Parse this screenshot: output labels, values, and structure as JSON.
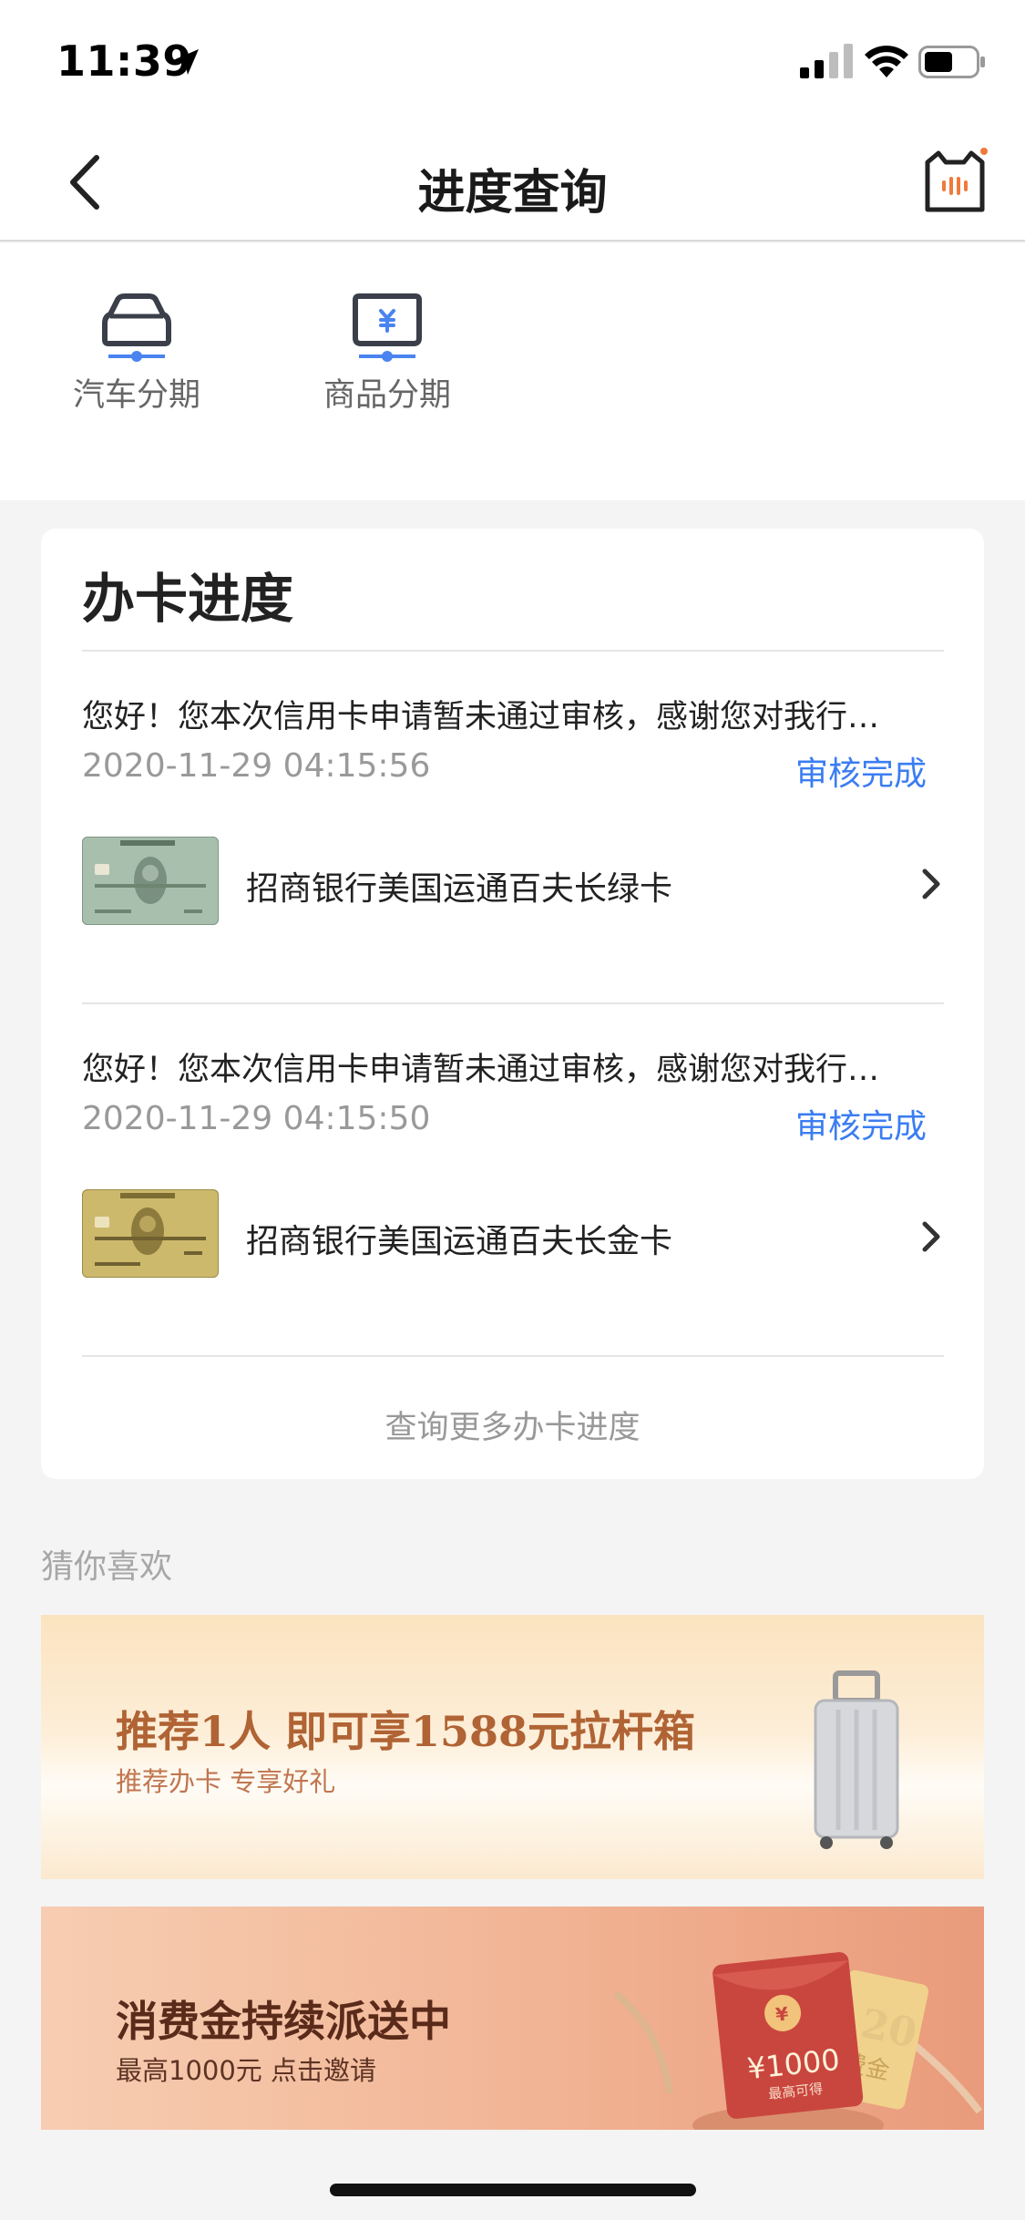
{
  "status_bar": {
    "time": "11:39"
  },
  "nav": {
    "title": "进度查询"
  },
  "categories": [
    {
      "label": "汽车分期",
      "icon": "car-icon"
    },
    {
      "label": "商品分期",
      "icon": "yuan-box-icon"
    }
  ],
  "progress": {
    "title": "办卡进度",
    "records": [
      {
        "message": "您好！您本次信用卡申请暂未通过审核，感谢您对我行…",
        "time": "2020-11-29 04:15:56",
        "status": "审核完成",
        "card_name": "招商银行美国运通百夫长绿卡",
        "card_image": "amex-green-card",
        "card_color": "#9fb7a7"
      },
      {
        "message": "您好！您本次信用卡申请暂未通过审核，感谢您对我行…",
        "time": "2020-11-29 04:15:50",
        "status": "审核完成",
        "card_name": "招商银行美国运通百夫长金卡",
        "card_image": "amex-gold-card",
        "card_color": "#c9b46a"
      }
    ],
    "more_link": "查询更多办卡进度"
  },
  "recommend": {
    "title": "猜你喜欢",
    "banners": [
      {
        "title": "推荐1人 即可享1588元拉杆箱",
        "subtitle": "推荐办卡 专享好礼",
        "image": "suitcase"
      },
      {
        "title": "消费金持续派送中",
        "subtitle": "最高1000元 点击邀请",
        "image": "red-packet",
        "packet_amount": "¥1000",
        "packet_note": "最高可得",
        "ticket_text": "20",
        "ticket_sub": "费金"
      }
    ]
  },
  "colors": {
    "accent": "#3b7df2",
    "icon_blue": "#4a84f0",
    "text_primary": "#222222",
    "text_secondary": "#999999"
  }
}
